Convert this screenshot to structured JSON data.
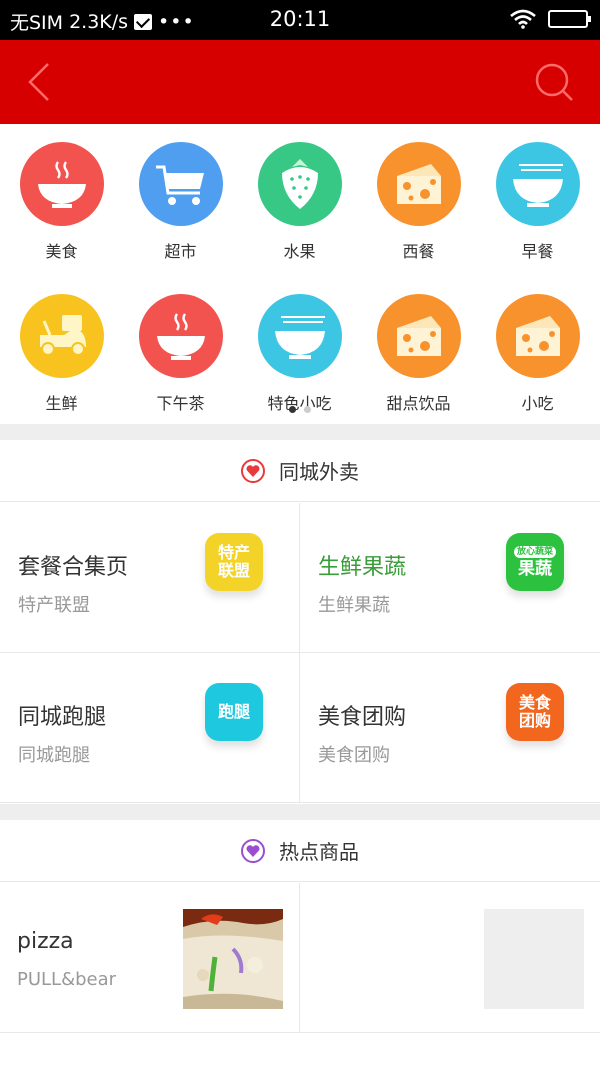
{
  "status_bar": {
    "carrier": "无SIM",
    "speed": "2.3K/s",
    "more": "•••",
    "time": "20:11"
  },
  "header": {
    "background": "#d60000",
    "back_icon": "chevron-left-icon",
    "search_icon": "search-icon"
  },
  "categories": [
    {
      "label": "美食",
      "icon": "bowl-icon",
      "color": "#f2534f"
    },
    {
      "label": "超市",
      "icon": "cart-icon",
      "color": "#4f9ef0"
    },
    {
      "label": "水果",
      "icon": "strawberry-icon",
      "color": "#37c886"
    },
    {
      "label": "西餐",
      "icon": "cheese-icon",
      "color": "#f7922c"
    },
    {
      "label": "早餐",
      "icon": "noodle-bowl-icon",
      "color": "#3cc6e3"
    },
    {
      "label": "生鲜",
      "icon": "scooter-icon",
      "color": "#f9c31f"
    },
    {
      "label": "下午茶",
      "icon": "bowl-icon",
      "color": "#f2534f"
    },
    {
      "label": "特色小吃",
      "icon": "noodle-bowl-icon",
      "color": "#3cc6e3"
    },
    {
      "label": "甜点饮品",
      "icon": "cheese-icon",
      "color": "#f7922c"
    },
    {
      "label": "小吃",
      "icon": "cheese-icon",
      "color": "#f7922c"
    }
  ],
  "pager": {
    "pages": 2,
    "active": 1
  },
  "section_delivery": {
    "title": "同城外卖",
    "heart_color": "#e83a3a",
    "cards": [
      {
        "title": "套餐合集页",
        "sub": "特产联盟",
        "badge": "特产\n联盟",
        "badge_color": "#f3d328",
        "title_color": "#333333"
      },
      {
        "title": "生鲜果蔬",
        "sub": "生鲜果蔬",
        "badge_top": "放心蔬菜",
        "badge": "果蔬",
        "badge_color": "#2cc23f",
        "title_color": "#3a9d3a"
      },
      {
        "title": "同城跑腿",
        "sub": "同城跑腿",
        "badge": "跑腿",
        "badge_color": "#1ec8de",
        "title_color": "#333333"
      },
      {
        "title": "美食团购",
        "sub": "美食团购",
        "badge": "美食\n团购",
        "badge_color": "#f2661e",
        "title_color": "#333333"
      }
    ]
  },
  "section_hot": {
    "title": "热点商品",
    "heart_color": "#9b4dcf",
    "products": [
      {
        "name": "pizza",
        "brand": "PULL&bear",
        "has_photo": true
      },
      {
        "name": "",
        "brand": "",
        "has_photo": false
      }
    ]
  }
}
